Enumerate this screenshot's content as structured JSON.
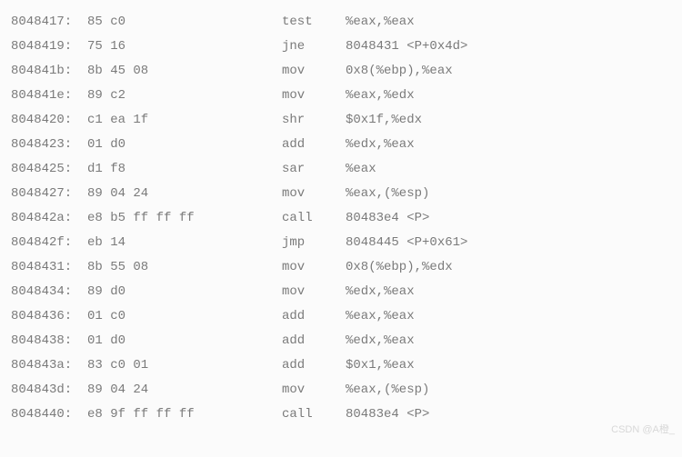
{
  "disassembly": [
    {
      "addr": "8048417:",
      "hex": "85 c0",
      "mnemonic": "test",
      "operands": "%eax,%eax"
    },
    {
      "addr": "8048419:",
      "hex": "75 16",
      "mnemonic": "jne",
      "operands": "8048431 <P+0x4d>"
    },
    {
      "addr": "804841b:",
      "hex": "8b 45 08",
      "mnemonic": "mov",
      "operands": "0x8(%ebp),%eax"
    },
    {
      "addr": "804841e:",
      "hex": "89 c2",
      "mnemonic": "mov",
      "operands": "%eax,%edx"
    },
    {
      "addr": "8048420:",
      "hex": "c1 ea 1f",
      "mnemonic": "shr",
      "operands": "$0x1f,%edx"
    },
    {
      "addr": "8048423:",
      "hex": "01 d0",
      "mnemonic": "add",
      "operands": "%edx,%eax"
    },
    {
      "addr": "8048425:",
      "hex": "d1 f8",
      "mnemonic": "sar",
      "operands": "%eax"
    },
    {
      "addr": "8048427:",
      "hex": "89 04 24",
      "mnemonic": "mov",
      "operands": "%eax,(%esp)"
    },
    {
      "addr": "804842a:",
      "hex": "e8 b5 ff ff ff",
      "mnemonic": "call",
      "operands": "80483e4 <P>"
    },
    {
      "addr": "804842f:",
      "hex": "eb 14",
      "mnemonic": "jmp",
      "operands": "8048445 <P+0x61>"
    },
    {
      "addr": "8048431:",
      "hex": "8b 55 08",
      "mnemonic": "mov",
      "operands": "0x8(%ebp),%edx"
    },
    {
      "addr": "8048434:",
      "hex": "89 d0",
      "mnemonic": "mov",
      "operands": "%edx,%eax"
    },
    {
      "addr": "8048436:",
      "hex": "01 c0",
      "mnemonic": "add",
      "operands": "%eax,%eax"
    },
    {
      "addr": "8048438:",
      "hex": "01 d0",
      "mnemonic": "add",
      "operands": "%edx,%eax"
    },
    {
      "addr": "804843a:",
      "hex": "83 c0 01",
      "mnemonic": "add",
      "operands": "$0x1,%eax"
    },
    {
      "addr": "804843d:",
      "hex": "89 04 24",
      "mnemonic": "mov",
      "operands": "%eax,(%esp)"
    },
    {
      "addr": "8048440:",
      "hex": "e8 9f ff ff ff",
      "mnemonic": "call",
      "operands": "80483e4 <P>"
    }
  ],
  "watermark": "CSDN @A橙_"
}
